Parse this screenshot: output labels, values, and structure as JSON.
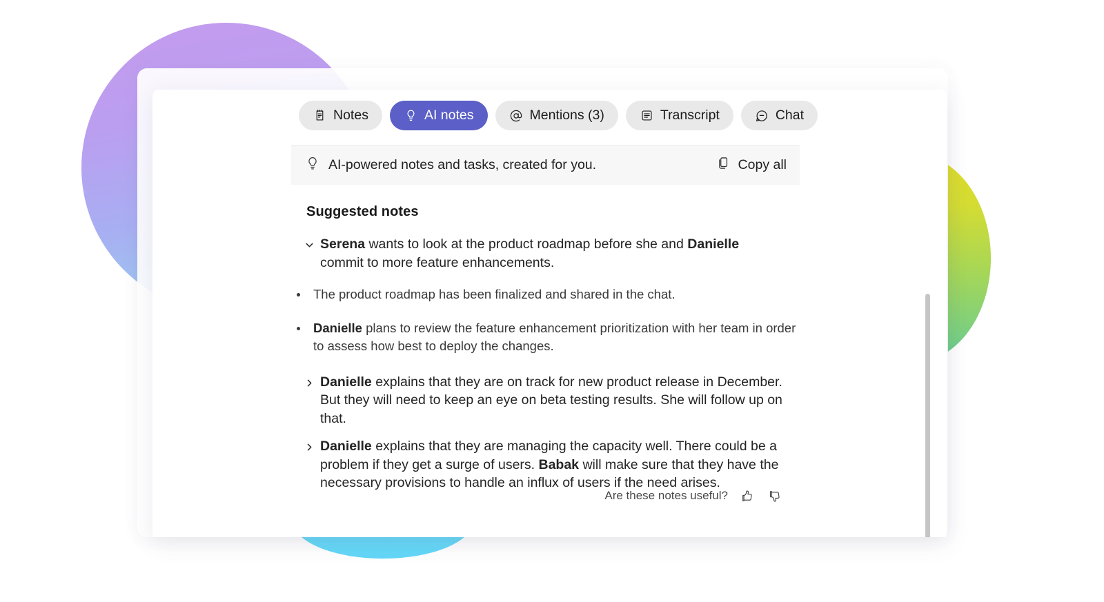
{
  "theme": {
    "accent": "#5b5fc7",
    "tab_bg": "#e9e9e9",
    "subheader_bg": "#f7f7f7",
    "text": "#242424",
    "scrollbar": "#c5c5c5"
  },
  "tabs": [
    {
      "id": "notes",
      "label": "Notes",
      "icon": "notepad-icon",
      "active": false
    },
    {
      "id": "ai-notes",
      "label": "AI notes",
      "icon": "lightbulb-icon",
      "active": true
    },
    {
      "id": "mentions",
      "label": "Mentions (3)",
      "icon": "at-icon",
      "active": false
    },
    {
      "id": "transcript",
      "label": "Transcript",
      "icon": "document-icon",
      "active": false
    },
    {
      "id": "chat",
      "label": "Chat",
      "icon": "chat-icon",
      "active": false
    }
  ],
  "subheader": {
    "icon": "lightbulb-icon",
    "text": "AI-powered notes and tasks, created for you.",
    "copy_all_label": "Copy all",
    "copy_all_icon": "copy-icon"
  },
  "notes_panel": {
    "section_title": "Suggested notes",
    "items": [
      {
        "expanded": true,
        "chevron": "chevron-down-icon",
        "segments": [
          {
            "text": "Serena",
            "bold": true
          },
          {
            "text": " wants to look at the product roadmap before she and ",
            "bold": false
          },
          {
            "text": "Danielle",
            "bold": true
          },
          {
            "text": " commit to more feature enhancements.",
            "bold": false
          }
        ],
        "sub_items": [
          [
            {
              "text": "The product roadmap has been finalized and shared in the chat.",
              "bold": false
            }
          ],
          [
            {
              "text": "Danielle",
              "bold": true
            },
            {
              "text": " plans to review the feature enhancement prioritization with her team in order to assess how best to deploy the changes.",
              "bold": false
            }
          ]
        ]
      },
      {
        "expanded": false,
        "chevron": "chevron-right-icon",
        "segments": [
          {
            "text": "Danielle",
            "bold": true
          },
          {
            "text": " explains that they are on track for new product release in December. But they will need to keep an eye on beta testing results. She will follow up on that.",
            "bold": false
          }
        ],
        "sub_items": []
      },
      {
        "expanded": false,
        "chevron": "chevron-right-icon",
        "segments": [
          {
            "text": "Danielle",
            "bold": true
          },
          {
            "text": " explains that they are managing the capacity well. There could be a problem if they get a surge of users. ",
            "bold": false
          },
          {
            "text": "Babak",
            "bold": true
          },
          {
            "text": " will make sure that they have the necessary provisions to handle an influx of users if the need arises.",
            "bold": false
          }
        ],
        "sub_items": []
      }
    ]
  },
  "feedback": {
    "label": "Are these notes useful?",
    "thumbs_up_icon": "thumbs-up-icon",
    "thumbs_down_icon": "thumbs-down-icon"
  },
  "scrollbar": {
    "orientation": "vertical"
  }
}
